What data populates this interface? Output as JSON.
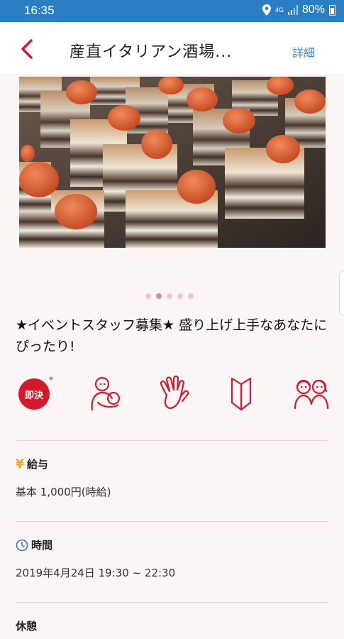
{
  "status_bar": {
    "time": "16:35",
    "network": "4G",
    "battery": "80%",
    "background": "#2a7fc4"
  },
  "app_bar": {
    "back_icon": "chevron-left-icon",
    "title": "産直イタリアン酒場...",
    "detail_label": "詳細",
    "accent": "#d6192a"
  },
  "carousel": {
    "image": "tiramisu-with-macarons",
    "page_count": 5,
    "active_index": 1
  },
  "job": {
    "title": "★イベントスタッフ募集★ 盛り上げ上手なあなたにぴったり!"
  },
  "features": [
    {
      "icon": "instant-decision-badge-icon",
      "label": "即決"
    },
    {
      "icon": "parent-child-icon"
    },
    {
      "icon": "waving-hand-icon"
    },
    {
      "icon": "beginner-mark-icon"
    },
    {
      "icon": "friends-pair-icon"
    }
  ],
  "salary": {
    "icon_label": "¥",
    "heading": "給与",
    "value": "基本 1,000円(時給)"
  },
  "time": {
    "icon": "clock-icon",
    "heading": "時間",
    "value": "2019年4月24日 19:30 ~ 22:30"
  },
  "break": {
    "heading": "休憩"
  }
}
